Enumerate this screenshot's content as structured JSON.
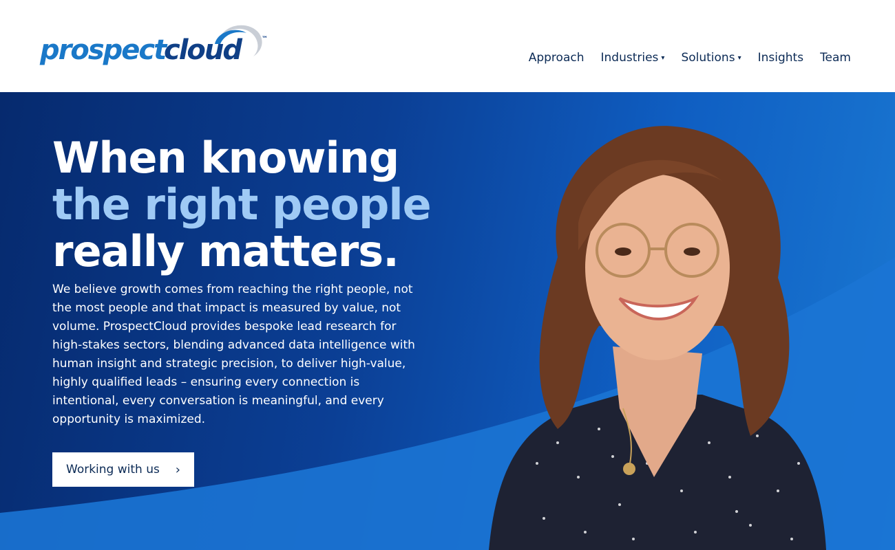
{
  "header": {
    "logo": {
      "part1": "prospect",
      "part2": "cloud",
      "trademark": "™"
    },
    "nav": [
      {
        "label": "Approach",
        "dropdown": false
      },
      {
        "label": "Industries",
        "dropdown": true
      },
      {
        "label": "Solutions",
        "dropdown": true
      },
      {
        "label": "Insights",
        "dropdown": false
      },
      {
        "label": "Team",
        "dropdown": false
      }
    ],
    "caret": "▾"
  },
  "hero": {
    "headline_line1": "When knowing",
    "headline_line2": "the right people",
    "headline_line3": "really matters.",
    "description": "We believe growth comes from reaching the right people, not the most people and that impact is measured by value, not volume. ProspectCloud provides bespoke lead research for high-stakes sectors, blending advanced data intelligence with human insight and strategic precision, to deliver high-value, highly qualified leads – ensuring every connection is intentional, every conversation is meaningful, and every opportunity is maximized.",
    "cta_label": "Working with us",
    "cta_icon": "chevron-right-icon",
    "cta_glyph": "›"
  },
  "colors": {
    "brand_light": "#1a78c8",
    "brand_dark": "#0f3f86",
    "hero_dark": "#062a6e",
    "hero_bright": "#1a78d2",
    "headline_accent": "#9fcaf5",
    "text_dark": "#0b2a55"
  }
}
